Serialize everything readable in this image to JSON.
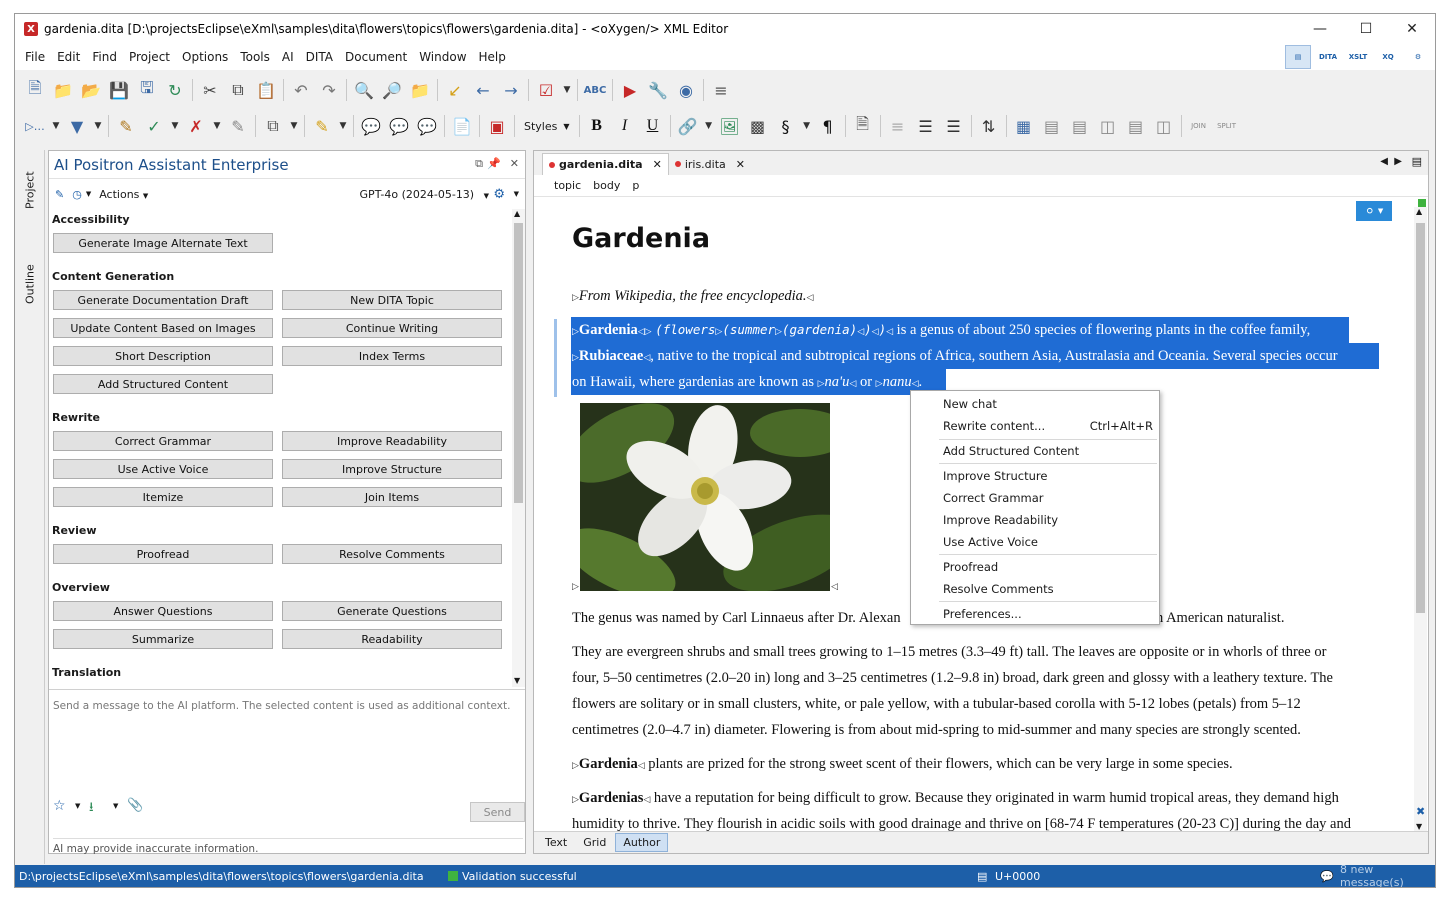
{
  "window": {
    "title": "gardenia.dita [D:\\projectsEclipse\\eXml\\samples\\dita\\flowers\\topics\\flowers\\gardenia.dita] - <oXygen/> XML Editor"
  },
  "menu": [
    "File",
    "Edit",
    "Find",
    "Project",
    "Options",
    "Tools",
    "AI",
    "DITA",
    "Document",
    "Window",
    "Help"
  ],
  "perspectives": [
    "DITA",
    "XSLT",
    "XQ"
  ],
  "toolbar": {
    "styles_label": "Styles"
  },
  "sidebar_tabs": {
    "project": "Project",
    "outline": "Outline"
  },
  "ai_panel": {
    "title": "AI Positron Assistant Enterprise",
    "actions_label": "Actions",
    "model": "GPT-4o (2024-05-13)",
    "sections": {
      "accessibility": "Accessibility",
      "content_generation": "Content Generation",
      "rewrite": "Rewrite",
      "review": "Review",
      "overview": "Overview",
      "translation": "Translation"
    },
    "buttons": {
      "generate_image_alt": "Generate Image Alternate Text",
      "generate_doc_draft": "Generate Documentation Draft",
      "new_dita_topic": "New DITA Topic",
      "update_content_images": "Update Content Based on Images",
      "continue_writing": "Continue Writing",
      "short_description": "Short Description",
      "index_terms": "Index Terms",
      "add_structured_content": "Add Structured Content",
      "correct_grammar": "Correct Grammar",
      "improve_readability": "Improve Readability",
      "use_active_voice": "Use Active Voice",
      "improve_structure": "Improve Structure",
      "itemize": "Itemize",
      "join_items": "Join Items",
      "proofread": "Proofread",
      "resolve_comments": "Resolve Comments",
      "answer_questions": "Answer Questions",
      "generate_questions": "Generate Questions",
      "summarize": "Summarize",
      "readability": "Readability"
    },
    "input_placeholder": "Send a message to the AI platform. The selected content is used as additional context.",
    "send_label": "Send",
    "disclaimer": "AI may provide inaccurate information."
  },
  "editor": {
    "tabs": [
      {
        "label": "gardenia.dita"
      },
      {
        "label": "iris.dita"
      }
    ],
    "breadcrumb": [
      "topic",
      "body",
      "p"
    ],
    "modes": [
      "Text",
      "Grid",
      "Author"
    ],
    "doc": {
      "title": "Gardenia",
      "source": "From Wikipedia, the free encyclopedia.",
      "p1": {
        "b1": "Gardenia",
        "m1": "(flowers",
        "m2": "(summer",
        "m3": "(gardenia)",
        "m4": ")",
        "m5": ")",
        "t1": " is a genus of about 250 species of flowering plants in the coffee family,",
        "b2": "Rubiaceae",
        "t2": ", native to the tropical and subtropical regions of Africa, southern Asia, Australasia and Oceania. Several species occur",
        "t3": "on Hawaii, where gardenias are known as ",
        "i1": "na'u",
        "t4": " or ",
        "i2": "nanu",
        "t5": "."
      },
      "p2_a": "The genus was named by Carl Linnaeus after Dr. Alexan",
      "p2_b": "n American naturalist.",
      "p3": [
        "They are evergreen shrubs and small trees growing to 1–15 metres (3.3–49 ft) tall. The leaves are opposite or in whorls of three or",
        "four, 5–50 centimetres (2.0–20 in) long and 3–25 centimetres (1.2–9.8 in) broad, dark green and glossy with a leathery texture. The",
        "flowers are solitary or in small clusters, white, or pale yellow, with a tubular-based corolla with 5-12 lobes (petals) from 5–12",
        "centimetres (2.0–4.7 in) diameter. Flowering is from about mid-spring to mid-summer and many species are strongly scented."
      ],
      "p4": {
        "b": "Gardenia",
        "t": " plants are prized for the strong sweet scent of their flowers, which can be very large in some species."
      },
      "p5": {
        "b": "Gardenias",
        "t": " have a reputation for being difficult to grow. Because they originated in warm humid tropical areas, they demand high",
        "t2": "humidity to thrive. They flourish in acidic soils with good drainage and thrive on [68-74 F temperatures (20-23 C)] during the day and"
      }
    },
    "context_menu": {
      "new_chat": "New chat",
      "rewrite": "Rewrite content...",
      "rewrite_shortcut": "Ctrl+Alt+R",
      "add_structured": "Add Structured Content",
      "improve_structure": "Improve Structure",
      "correct_grammar": "Correct Grammar",
      "improve_readability": "Improve Readability",
      "use_active_voice": "Use Active Voice",
      "proofread": "Proofread",
      "resolve_comments": "Resolve Comments",
      "preferences": "Preferences..."
    }
  },
  "status": {
    "path": "D:\\projectsEclipse\\eXml\\samples\\dita\\flowers\\topics\\flowers\\gardenia.dita",
    "validation": "Validation successful",
    "unicode": "U+0000",
    "messages": "8 new message(s)"
  },
  "colors": {
    "selection": "#1f6cd4",
    "status_bar": "#1d5fa8",
    "accent": "#1d4f8a"
  }
}
